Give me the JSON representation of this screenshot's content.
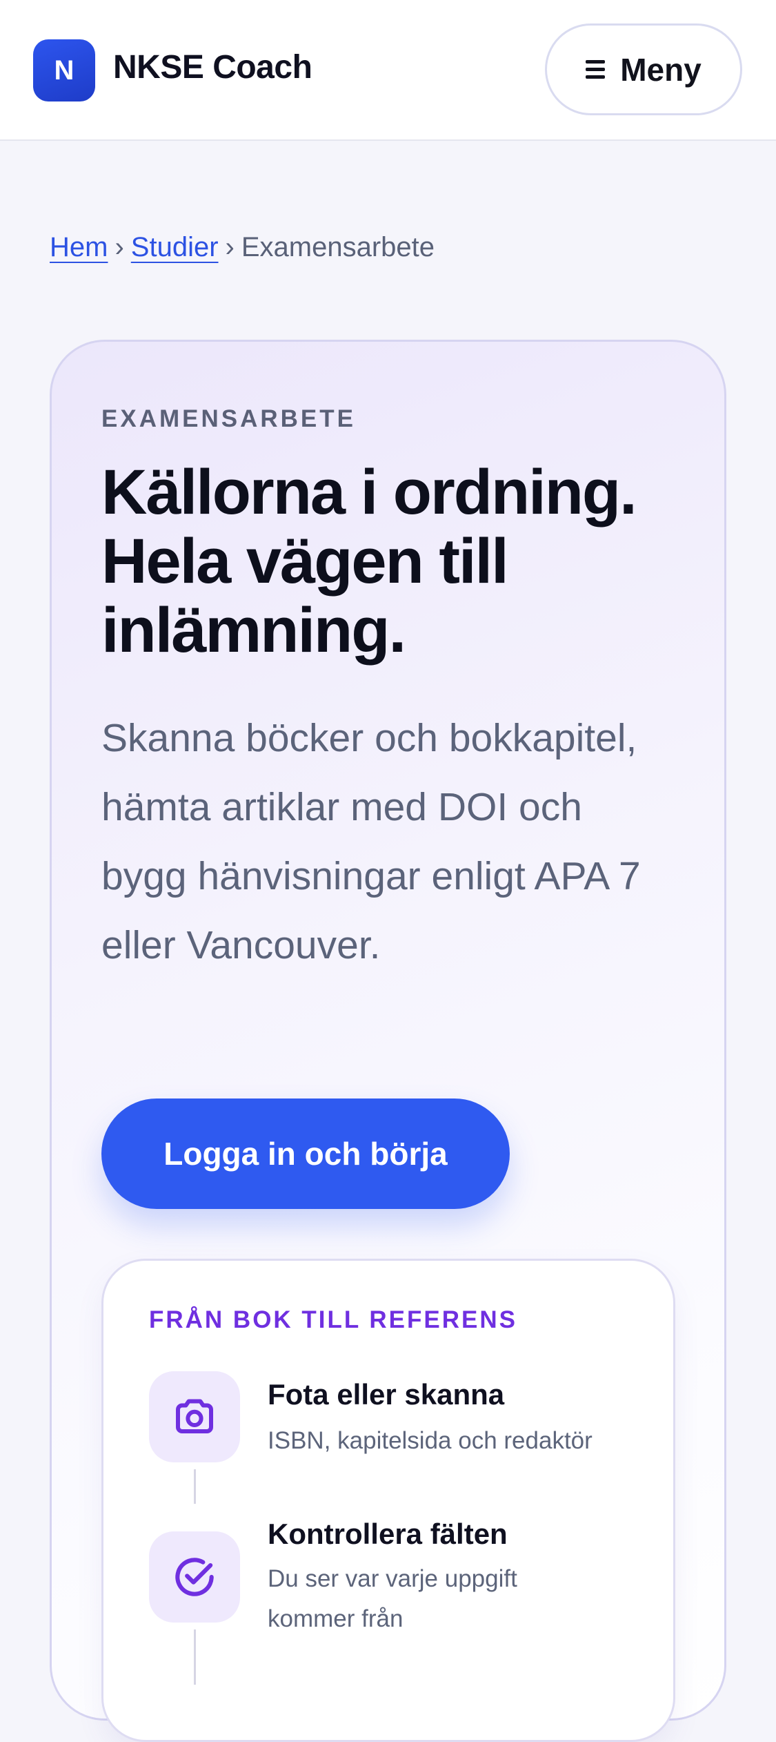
{
  "header": {
    "logo_letter": "N",
    "brand": "NKSE Coach",
    "menu_label": "Meny"
  },
  "breadcrumb": {
    "items": [
      "Hem",
      "Studier",
      "Examensarbete"
    ],
    "separator": "›"
  },
  "hero": {
    "eyebrow": "EXAMENSARBETE",
    "title_lines": [
      "Källorna i ordning.",
      "Hela vägen till",
      "inlämning."
    ],
    "lead": "Skanna böcker och bokkapitel, hämta artiklar med DOI och bygg hänvisningar enligt APA 7 eller Vancouver.",
    "cta_label": "Logga in och börja"
  },
  "steps": {
    "heading": "FRÅN BOK TILL REFERENS",
    "items": [
      {
        "icon": "camera-icon",
        "title": "Fota eller skanna",
        "desc": "ISBN, kapitelsida och redaktör"
      },
      {
        "icon": "check-circle-icon",
        "title": "Kontrollera fälten",
        "desc": "Du ser var varje uppgift kommer från"
      }
    ]
  },
  "colors": {
    "accent": "#2f5af0",
    "link": "#2c52e3",
    "purple": "#6f2fe0",
    "icon_bg": "#efe9fd",
    "page_bg": "#f5f5fb"
  }
}
